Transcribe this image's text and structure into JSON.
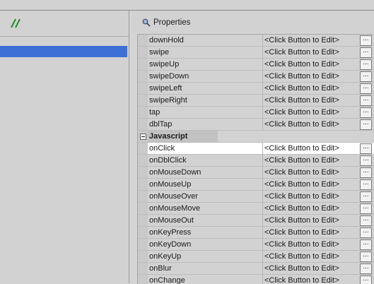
{
  "panel": {
    "title": "Properties"
  },
  "properties": [
    {
      "name": "downHold",
      "value": "<Click Button to Edit>",
      "button": "..."
    },
    {
      "name": "swipe",
      "value": "<Click Button to Edit>",
      "button": "..."
    },
    {
      "name": "swipeUp",
      "value": "<Click Button to Edit>",
      "button": "..."
    },
    {
      "name": "swipeDown",
      "value": "<Click Button to Edit>",
      "button": "..."
    },
    {
      "name": "swipeLeft",
      "value": "<Click Button to Edit>",
      "button": "..."
    },
    {
      "name": "swipeRight",
      "value": "<Click Button to Edit>",
      "button": "..."
    },
    {
      "name": "tap",
      "value": "<Click Button to Edit>",
      "button": "..."
    },
    {
      "name": "dblTap",
      "value": "<Click Button to Edit>",
      "button": "..."
    }
  ],
  "category": {
    "name": "Javascript"
  },
  "js_properties": [
    {
      "name": "onClick",
      "value": "<Click Button to Edit>",
      "button": "..."
    },
    {
      "name": "onDblClick",
      "value": "<Click Button to Edit>",
      "button": "..."
    },
    {
      "name": "onMouseDown",
      "value": "<Click Button to Edit>",
      "button": "..."
    },
    {
      "name": "onMouseUp",
      "value": "<Click Button to Edit>",
      "button": "..."
    },
    {
      "name": "onMouseOver",
      "value": "<Click Button to Edit>",
      "button": "..."
    },
    {
      "name": "onMouseMove",
      "value": "<Click Button to Edit>",
      "button": "..."
    },
    {
      "name": "onMouseOut",
      "value": "<Click Button to Edit>",
      "button": "..."
    },
    {
      "name": "onKeyPress",
      "value": "<Click Button to Edit>",
      "button": "..."
    },
    {
      "name": "onKeyDown",
      "value": "<Click Button to Edit>",
      "button": "..."
    },
    {
      "name": "onKeyUp",
      "value": "<Click Button to Edit>",
      "button": "..."
    },
    {
      "name": "onBlur",
      "value": "<Click Button to Edit>",
      "button": "..."
    },
    {
      "name": "onChange",
      "value": "<Click Button to Edit>",
      "button": "..."
    }
  ],
  "icons": {
    "left_header": "resize-grip-icon",
    "properties": "search-icon",
    "collapse": "collapse-minus-icon"
  },
  "colors": {
    "selection": "#3e6fd6",
    "selected_row": "#ffffff",
    "panel_bg": "#d2d2d2",
    "icon_green": "#2e8b2e"
  }
}
